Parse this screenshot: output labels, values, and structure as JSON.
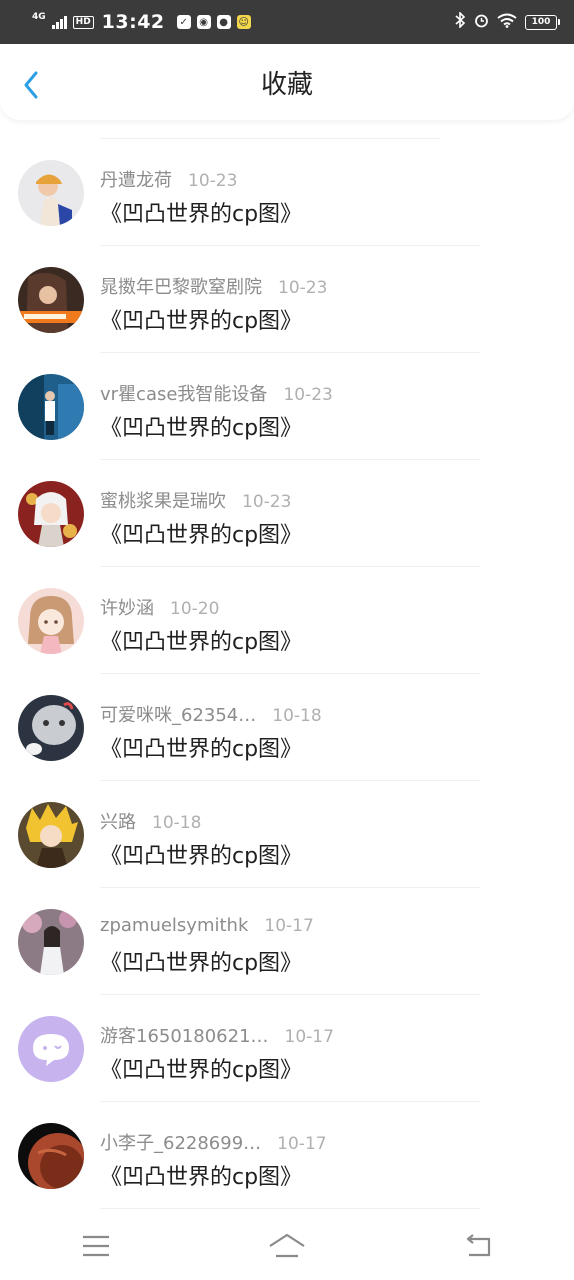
{
  "status_bar": {
    "network": "4G",
    "hd": "HD",
    "time": "13:42",
    "battery": "100"
  },
  "header": {
    "title": "收藏"
  },
  "items": [
    {
      "user": "丹遭龙荷",
      "date": "10-23",
      "title": "《凹凸世界的cp图》"
    },
    {
      "user": "晁擞年巴黎歌窒剧院",
      "date": "10-23",
      "title": "《凹凸世界的cp图》"
    },
    {
      "user": "vr瞿case我智能设备",
      "date": "10-23",
      "title": "《凹凸世界的cp图》"
    },
    {
      "user": "蜜桃浆果是瑞吹",
      "date": "10-23",
      "title": "《凹凸世界的cp图》"
    },
    {
      "user": "许妙涵",
      "date": "10-20",
      "title": "《凹凸世界的cp图》"
    },
    {
      "user": "可爱咪咪_62354…",
      "date": "10-18",
      "title": "《凹凸世界的cp图》"
    },
    {
      "user": "兴路",
      "date": "10-18",
      "title": "《凹凸世界的cp图》"
    },
    {
      "user": "zpamuelsymithk",
      "date": "10-17",
      "title": "《凹凸世界的cp图》"
    },
    {
      "user": "游客1650180621…",
      "date": "10-17",
      "title": "《凹凸世界的cp图》"
    },
    {
      "user": "小李子_6228699…",
      "date": "10-17",
      "title": "《凹凸世界的cp图》"
    }
  ],
  "colors": {
    "accent": "#2b9fe6",
    "status_bar_bg": "#3b3b3b",
    "username": "#8c8c8c",
    "date": "#b0b0b0"
  },
  "icons": {
    "back": "chevron-left-icon",
    "nav_menu": "menu-icon",
    "nav_home": "home-icon",
    "nav_back": "return-icon"
  }
}
